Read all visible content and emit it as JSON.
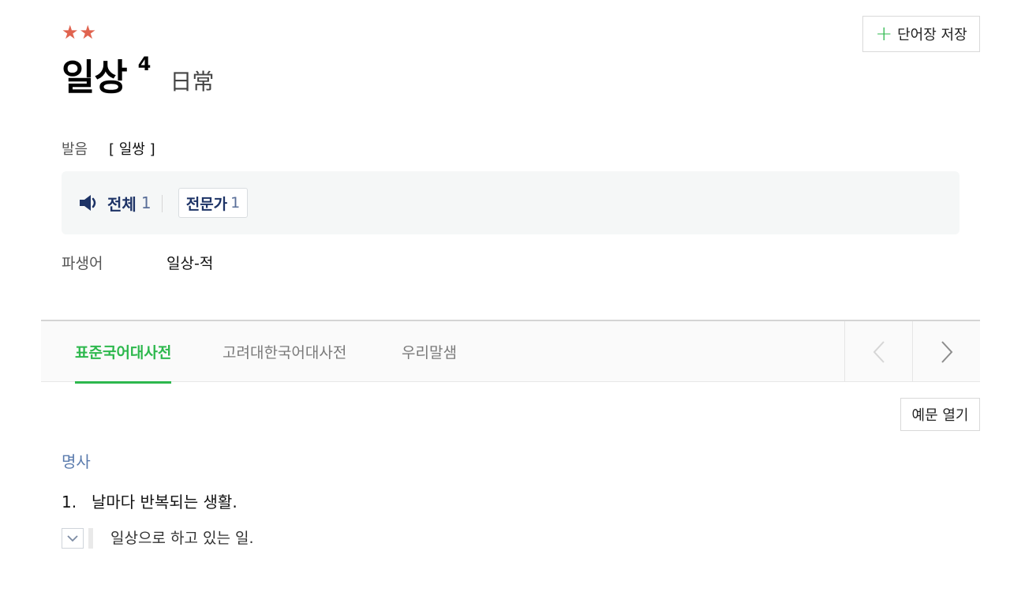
{
  "entry": {
    "stars": "★★",
    "word": "일상",
    "homonym_number": "4",
    "hanja": "日常"
  },
  "save_button": {
    "plus": "+",
    "label": "단어장 저장"
  },
  "pronunciation": {
    "label": "발음",
    "value": "[ 일쌍 ]"
  },
  "audio": {
    "all_label": "전체",
    "all_count": "1",
    "expert_label": "전문가",
    "expert_count": "1"
  },
  "derivative": {
    "label": "파생어",
    "value": "일상-적"
  },
  "tabs": [
    {
      "label": "표준국어대사전",
      "active": true
    },
    {
      "label": "고려대한국어대사전",
      "active": false
    },
    {
      "label": "우리말샘",
      "active": false
    }
  ],
  "example_button": {
    "label": "예문 열기"
  },
  "definition": {
    "part_of_speech": "명사",
    "senses": [
      {
        "number": "1.",
        "text": "날마다 반복되는 생활."
      }
    ],
    "sub_meaning": "일상으로 하고 있는 일."
  },
  "colors": {
    "accent_green": "#2db84d",
    "star_red": "#e0634f",
    "navy": "#1d3366",
    "pos_blue": "#5a7bad"
  }
}
